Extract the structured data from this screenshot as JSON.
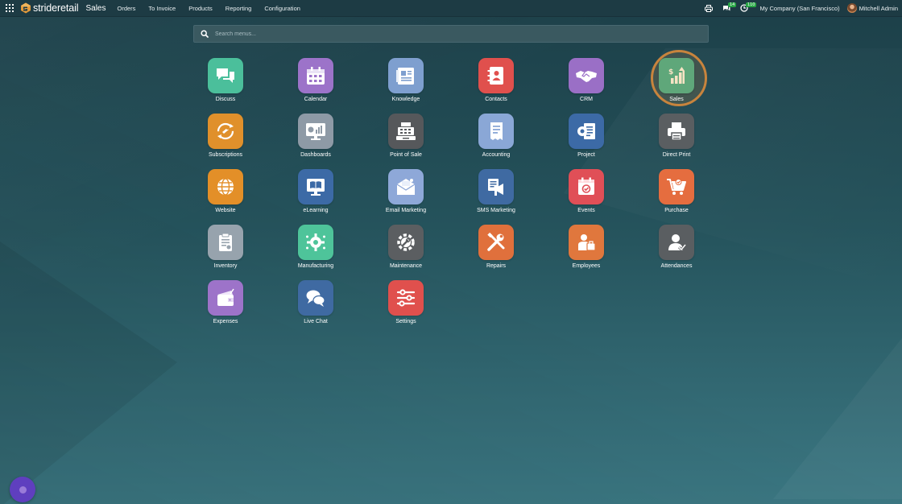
{
  "navbar": {
    "brand_part1": "stride",
    "brand_part2": "retail",
    "app_name": "Sales",
    "menu": [
      "Orders",
      "To Invoice",
      "Products",
      "Reporting",
      "Configuration"
    ],
    "messages_count": "14",
    "activities_count": "110",
    "company": "My Company (San Francisco)",
    "user": "Mitchell Admin"
  },
  "search": {
    "placeholder": "Search menus..."
  },
  "apps": [
    {
      "label": "Discuss",
      "color": "#4bbf9b",
      "icon": "chat-bubbles-icon"
    },
    {
      "label": "Calendar",
      "color": "#9c73c9",
      "icon": "calendar-icon"
    },
    {
      "label": "Knowledge",
      "color": "#7e9fcf",
      "icon": "knowledge-book-icon"
    },
    {
      "label": "Contacts",
      "color": "#e0504d",
      "icon": "contacts-book-icon"
    },
    {
      "label": "CRM",
      "color": "#9a6fc6",
      "icon": "handshake-icon"
    },
    {
      "label": "Sales",
      "color": "#5fa77a",
      "icon": "sales-chart-icon"
    },
    {
      "label": "Subscriptions",
      "color": "#e0902b",
      "icon": "subscription-cycle-icon"
    },
    {
      "label": "Dashboards",
      "color": "#8e9aa6",
      "icon": "dashboard-monitor-icon"
    },
    {
      "label": "Point of Sale",
      "color": "#56585b",
      "icon": "cash-register-icon"
    },
    {
      "label": "Accounting",
      "color": "#8aa7d6",
      "icon": "accounting-receipt-icon"
    },
    {
      "label": "Project",
      "color": "#3c6aa6",
      "icon": "project-gear-doc-icon"
    },
    {
      "label": "Direct Print",
      "color": "#5a5e61",
      "icon": "printer-icon"
    },
    {
      "label": "Website",
      "color": "#e38f28",
      "icon": "globe-icon"
    },
    {
      "label": "eLearning",
      "color": "#3c6aa6",
      "icon": "elearning-book-icon"
    },
    {
      "label": "Email Marketing",
      "color": "#8ea8d8",
      "icon": "envelope-icon"
    },
    {
      "label": "SMS Marketing",
      "color": "#3f6aa2",
      "icon": "sms-megaphone-icon"
    },
    {
      "label": "Events",
      "color": "#e04f57",
      "icon": "event-calendar-icon"
    },
    {
      "label": "Purchase",
      "color": "#e56d3f",
      "icon": "shopping-cart-icon"
    },
    {
      "label": "Inventory",
      "color": "#97a3ad",
      "icon": "clipboard-icon"
    },
    {
      "label": "Manufacturing",
      "color": "#4ec49a",
      "icon": "manufacturing-gear-icon"
    },
    {
      "label": "Maintenance",
      "color": "#5b5e61",
      "icon": "maintenance-gear-icon"
    },
    {
      "label": "Repairs",
      "color": "#e0703c",
      "icon": "tools-icon"
    },
    {
      "label": "Employees",
      "color": "#e0773d",
      "icon": "employees-icon"
    },
    {
      "label": "Attendances",
      "color": "#5a5e61",
      "icon": "attendance-user-icon"
    },
    {
      "label": "Expenses",
      "color": "#9d73c9",
      "icon": "wallet-icon"
    },
    {
      "label": "Live Chat",
      "color": "#3f6aa2",
      "icon": "live-chat-icon"
    },
    {
      "label": "Settings",
      "color": "#e0504d",
      "icon": "settings-sliders-icon"
    }
  ],
  "highlighted_app": "Sales",
  "accent_color": "#c8843d"
}
